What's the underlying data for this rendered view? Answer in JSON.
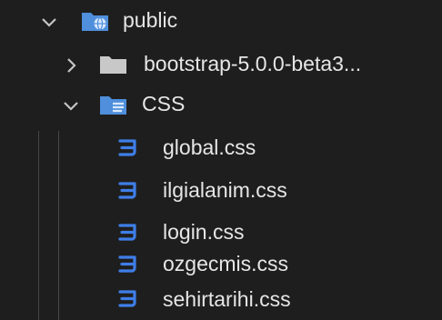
{
  "explorer": {
    "items": [
      {
        "label": "public",
        "type": "folder",
        "state": "expanded",
        "icon": "folder-public-icon"
      },
      {
        "label": "bootstrap-5.0.0-beta3...",
        "type": "folder",
        "state": "collapsed",
        "icon": "folder-icon"
      },
      {
        "label": "CSS",
        "type": "folder",
        "state": "expanded",
        "icon": "folder-css-icon"
      },
      {
        "label": "global.css",
        "type": "file",
        "icon": "css-file-icon"
      },
      {
        "label": "ilgialanim.css",
        "type": "file",
        "icon": "css-file-icon"
      },
      {
        "label": "login.css",
        "type": "file",
        "icon": "css-file-icon"
      },
      {
        "label": "ozgecmis.css",
        "type": "file",
        "icon": "css-file-icon"
      },
      {
        "label": "sehirtarihi.css",
        "type": "file",
        "icon": "css-file-icon"
      }
    ]
  },
  "colors": {
    "background": "#1e1e1e",
    "text": "#e6e6e6",
    "chevron": "#c5c5c5",
    "folder_blue": "#4f8fdc",
    "folder_grey": "#c8c8c8",
    "css_icon": "#3f7ee8",
    "indent_guide": "#474747"
  }
}
